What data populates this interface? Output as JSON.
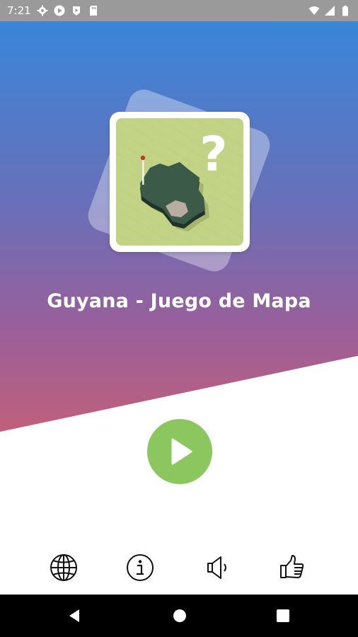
{
  "status_bar": {
    "time": "7:21",
    "left_icons": [
      "gear-icon",
      "play-store-icon",
      "play-circle-icon",
      "sd-card-icon"
    ],
    "right_icons": [
      "wifi-icon",
      "signal-icon",
      "battery-icon"
    ]
  },
  "app": {
    "title": "Guyana - Juego de Mapa",
    "logo_question_mark": "?"
  },
  "main": {
    "play_button_icon": "play-icon"
  },
  "toolbar": {
    "items": [
      {
        "icon": "globe-icon"
      },
      {
        "icon": "info-icon"
      },
      {
        "icon": "sound-icon"
      },
      {
        "icon": "thumbs-up-icon"
      }
    ]
  },
  "nav": {
    "items": [
      "back-icon",
      "home-icon",
      "recents-icon"
    ]
  },
  "colors": {
    "gradient_top": "#3a86d9",
    "gradient_bottom": "#c0607a",
    "play_green": "#8cc65e",
    "map_background": "#c3d386",
    "map_land": "#2f4a3c"
  }
}
